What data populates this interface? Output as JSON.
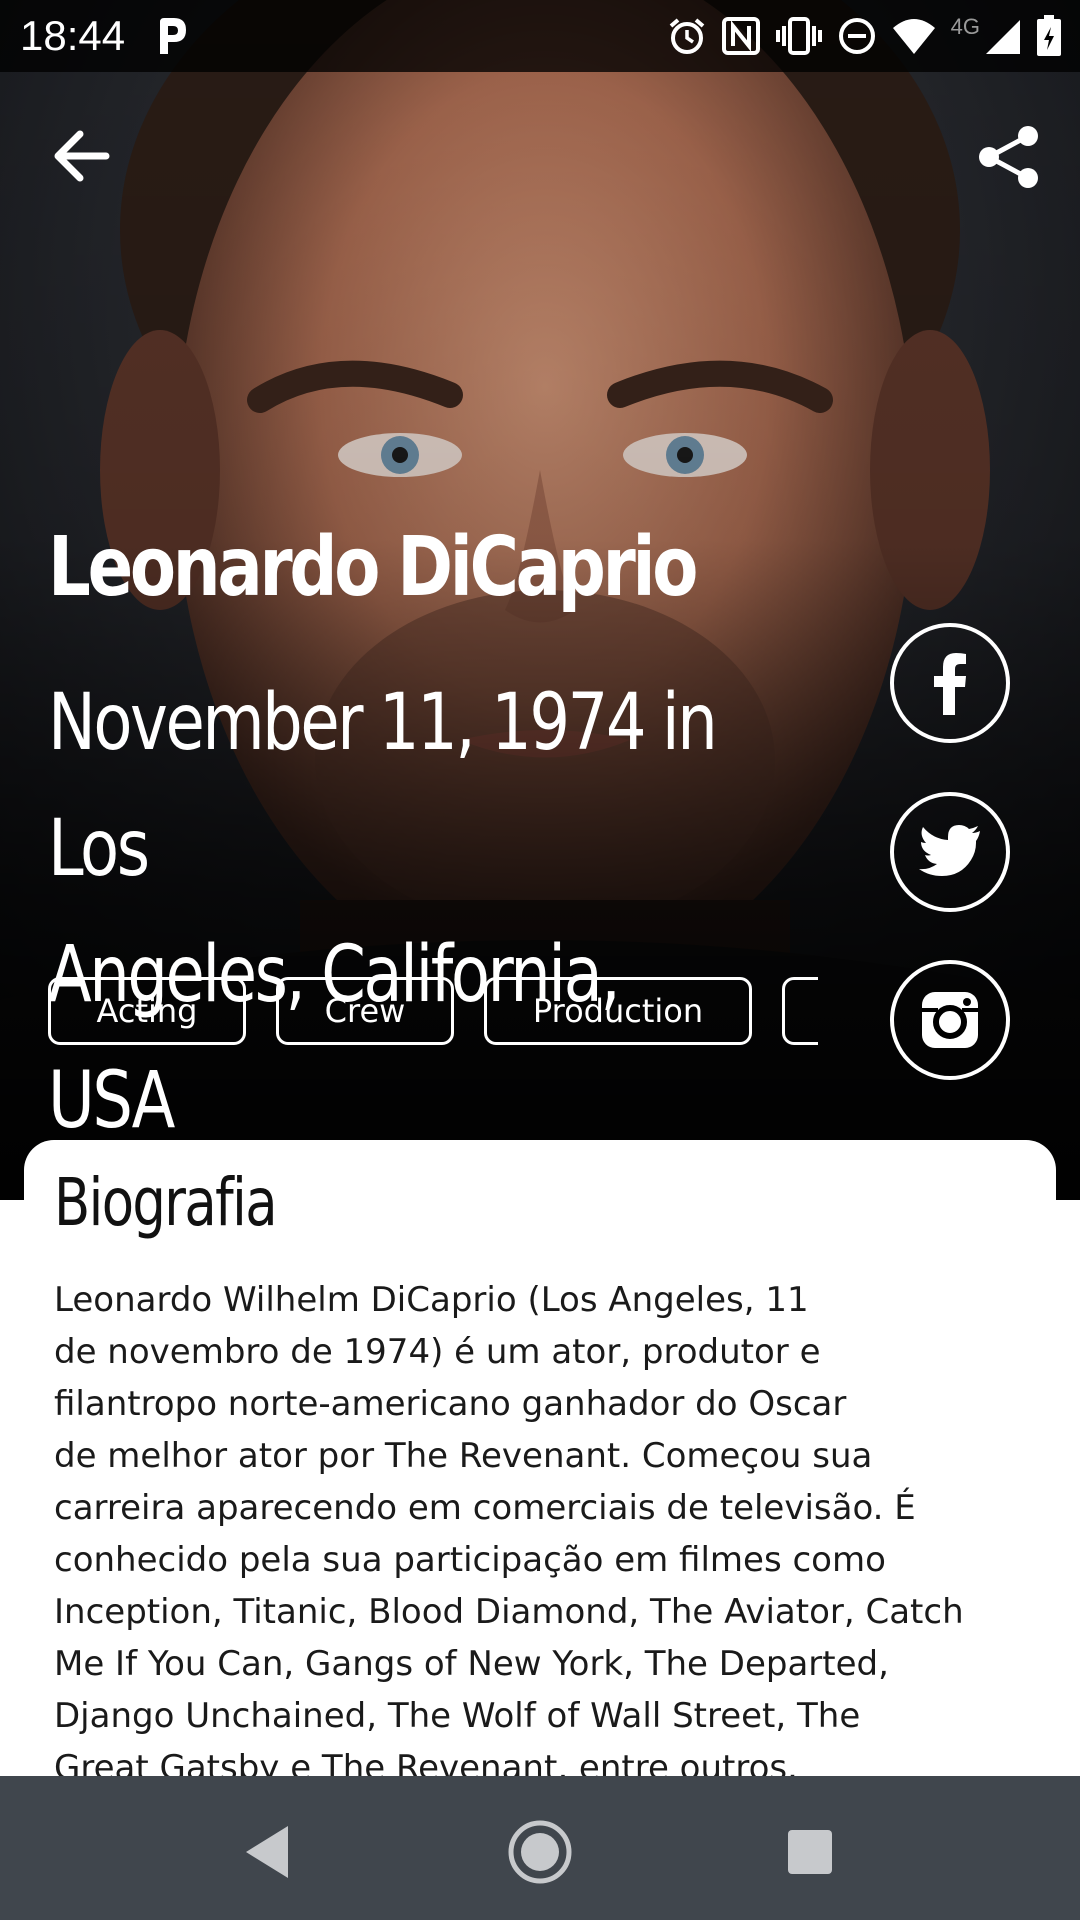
{
  "status_bar": {
    "time": "18:44",
    "network_label": "4G",
    "icons": [
      "parking-app-icon",
      "alarm-icon",
      "nfc-icon",
      "vibrate-icon",
      "do-not-disturb-icon",
      "wifi-icon",
      "cell-signal-icon",
      "battery-charging-icon"
    ]
  },
  "toolbar": {
    "back_icon": "arrow-back-icon",
    "share_icon": "share-icon"
  },
  "person": {
    "name": "Leonardo DiCaprio",
    "birth_line_1": "November 11, 1974 in Los",
    "birth_line_2": "Angeles, California, USA"
  },
  "departments": [
    {
      "label": "Acting"
    },
    {
      "label": "Crew"
    },
    {
      "label": "Production"
    },
    {
      "label": ""
    }
  ],
  "social": [
    {
      "icon": "facebook-icon"
    },
    {
      "icon": "twitter-icon"
    },
    {
      "icon": "instagram-icon"
    }
  ],
  "biography": {
    "title": "Biografia",
    "lines": [
      "Leonardo Wilhelm DiCaprio (Los Angeles, 11",
      "de novembro de 1974) é um ator, produtor e",
      "filantropo norte-americano ganhador do Oscar",
      "de melhor ator por The Revenant. Começou sua",
      "carreira aparecendo em comerciais de televisão. É",
      "conhecido pela sua participação em filmes como",
      "Inception, Titanic, Blood Diamond, The Aviator, Catch",
      "Me If You Can, Gangs of New York, The Departed,",
      "Django Unchained, The Wolf of Wall Street, The",
      "Great Gatsby e The Revenant, entre outros."
    ]
  },
  "navigation": {
    "icons": [
      "nav-back-icon",
      "nav-home-icon",
      "nav-recents-icon"
    ]
  },
  "colors": {
    "hero_background": "#0c0c0e",
    "card_background": "#ffffff",
    "nav_bar": "#40464d",
    "text_light": "#ffffff",
    "text_dark": "#1a1a1a"
  }
}
